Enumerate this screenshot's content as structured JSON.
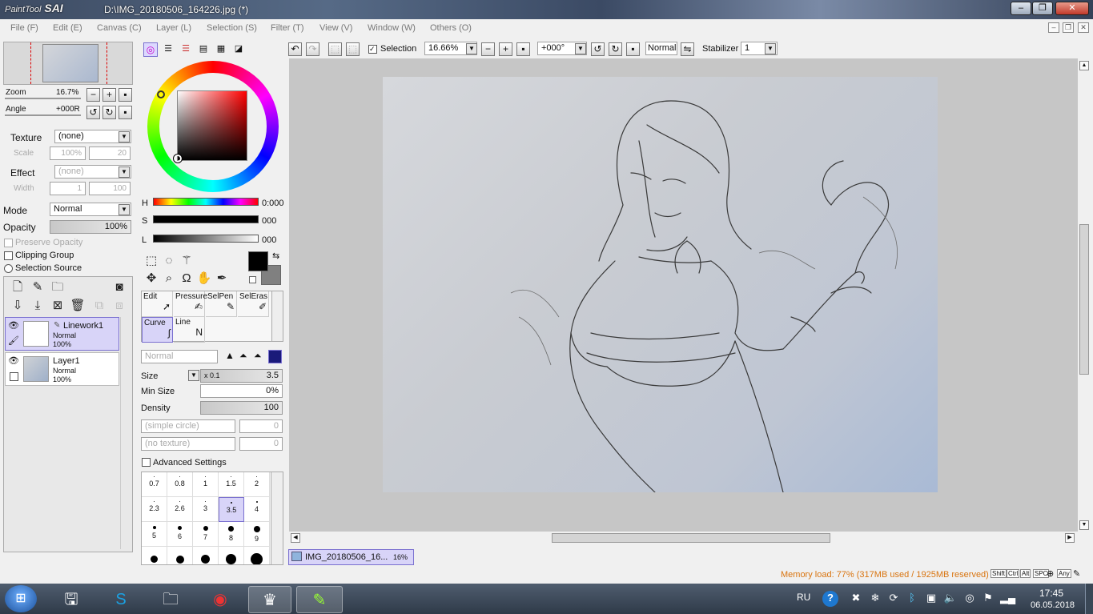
{
  "window": {
    "app_name": "PaintTool",
    "app_name_bold": "SAI",
    "title": "D:\\IMG_20180506_164226.jpg (*)"
  },
  "menu": [
    "File (F)",
    "Edit (E)",
    "Canvas (C)",
    "Layer (L)",
    "Selection (S)",
    "Filter (T)",
    "View (V)",
    "Window (W)",
    "Others (O)"
  ],
  "navigator": {
    "zoom_label": "Zoom",
    "zoom_value": "16.7%",
    "angle_label": "Angle",
    "angle_value": "+000R"
  },
  "texture": {
    "label": "Texture",
    "value": "(none)",
    "scale_label": "Scale",
    "scale_value": "100%",
    "scale_num": "20"
  },
  "effect": {
    "label": "Effect",
    "value": "(none)",
    "width_label": "Width",
    "width_value": "1",
    "width_num": "100"
  },
  "layer_props": {
    "mode_label": "Mode",
    "mode_value": "Normal",
    "opacity_label": "Opacity",
    "opacity_value": "100%",
    "preserve_opacity": "Preserve Opacity",
    "clipping_group": "Clipping Group",
    "selection_source": "Selection Source"
  },
  "layers": [
    {
      "name": "Linework1",
      "mode": "Normal",
      "opacity": "100%",
      "selected": true
    },
    {
      "name": "Layer1",
      "mode": "Normal",
      "opacity": "100%",
      "selected": false
    }
  ],
  "color": {
    "h_label": "H",
    "h_value": "0:000",
    "s_label": "S",
    "s_value": "000",
    "l_label": "L",
    "l_value": "000",
    "primary": "#000000",
    "secondary": "#808080"
  },
  "tools": [
    {
      "label": "Edit"
    },
    {
      "label": "Pressure"
    },
    {
      "label": "SelPen"
    },
    {
      "label": "SelEras"
    },
    {
      "label": "Curve"
    },
    {
      "label": "Line"
    }
  ],
  "brush": {
    "blend_mode": "Normal",
    "size_label": "Size",
    "size_mult": "x 0.1",
    "size_value": "3.5",
    "min_size_label": "Min Size",
    "min_size_value": "0%",
    "density_label": "Density",
    "density_value": "100",
    "shape": "(simple circle)",
    "shape_value": "0",
    "texture": "(no texture)",
    "texture_value": "0",
    "advanced": "Advanced Settings",
    "sizes": [
      "0.7",
      "0.8",
      "1",
      "1.5",
      "2",
      "2.3",
      "2.6",
      "3",
      "3.5",
      "4",
      "5",
      "6",
      "7",
      "8",
      "9",
      "",
      "",
      "",
      "",
      ""
    ],
    "selected_size": "3.5"
  },
  "toolbar": {
    "selection_label": "Selection",
    "zoom_value": "16.66%",
    "angle_value": "+000°",
    "mode_value": "Normal",
    "stabilizer_label": "Stabilizer",
    "stabilizer_value": "1"
  },
  "doc_tab": {
    "name": "IMG_20180506_16...",
    "zoom": "16%"
  },
  "status": {
    "memory": "Memory load: 77% (317MB used / 1925MB reserved)",
    "keys": [
      "Shift",
      "Ctrl",
      "Alt",
      "SPC",
      "Any"
    ]
  },
  "taskbar": {
    "language": "RU",
    "time": "17:45",
    "date": "06.05.2018"
  }
}
